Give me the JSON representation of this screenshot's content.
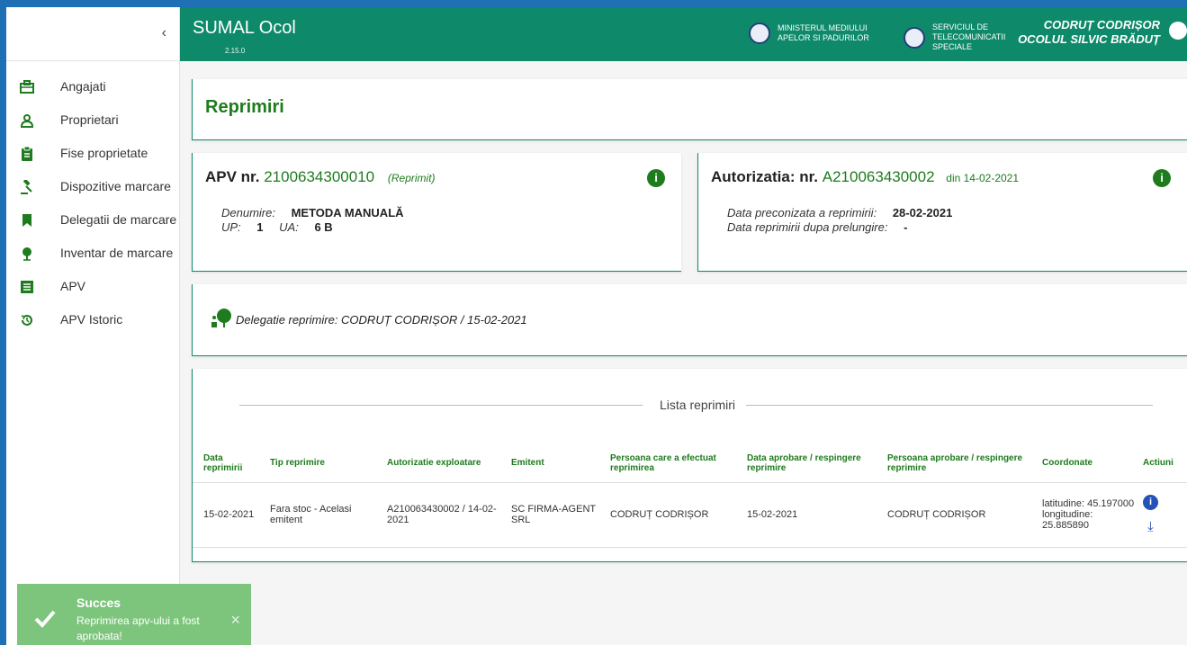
{
  "sidebar": {
    "collapse_glyph": "‹",
    "items": [
      {
        "label": "Angajati",
        "icon": "briefcase-icon"
      },
      {
        "label": "Proprietari",
        "icon": "person-icon"
      },
      {
        "label": "Fise proprietate",
        "icon": "clipboard-icon"
      },
      {
        "label": "Dispozitive marcare",
        "icon": "gavel-icon"
      },
      {
        "label": "Delegatii de marcare",
        "icon": "bookmark-icon"
      },
      {
        "label": "Inventar de marcare",
        "icon": "tree-icon"
      },
      {
        "label": "APV",
        "icon": "list-icon"
      },
      {
        "label": "APV Istoric",
        "icon": "history-icon"
      }
    ]
  },
  "topbar": {
    "app_title": "SUMAL Ocol",
    "version": "2.15.0",
    "org1": "MINISTERUL MEDIULUI APELOR SI PADURILOR",
    "org2": "SERVICIUL DE TELECOMUNICATII SPECIALE",
    "user_name": "CODRUȚ CODRIȘOR",
    "user_unit": "OCOLUL SILVIC BRĂDUȚ"
  },
  "page": {
    "title": "Reprimiri"
  },
  "apv_card": {
    "label": "APV nr.",
    "number": "2100634300010",
    "tag": "(Reprimit)",
    "denumire_label": "Denumire:",
    "denumire_value": "METODA MANUALĂ",
    "up_label": "UP:",
    "up_value": "1",
    "ua_label": "UA:",
    "ua_value": "6 B"
  },
  "auth_card": {
    "label": "Autorizatia: nr.",
    "number": "A210063430002",
    "date": "din 14-02-2021",
    "preconizata_label": "Data preconizata a reprimirii:",
    "preconizata_value": "28-02-2021",
    "prelungire_label": "Data reprimirii dupa prelungire:",
    "prelungire_value": "-"
  },
  "delegation": {
    "text": "Delegatie reprimire:  CODRUȚ CODRIȘOR / 15-02-2021"
  },
  "list": {
    "title": "Lista reprimiri",
    "columns": [
      "Data reprimirii",
      "Tip reprimire",
      "Autorizatie exploatare",
      "Emitent",
      "Persoana care a efectuat reprimirea",
      "Data aprobare / respingere reprimire",
      "Persoana aprobare / respingere reprimire",
      "Coordonate",
      "Actiuni"
    ],
    "rows": [
      {
        "data": "15-02-2021",
        "tip": "Fara stoc  - Acelasi emitent",
        "autorizatie": "A210063430002 / 14-02-2021",
        "emitent": "SC FIRMA-AGENT SRL",
        "persoana": "CODRUȚ CODRIȘOR",
        "data_aprobare": "15-02-2021",
        "persoana_aprobare": "CODRUȚ CODRIȘOR",
        "coordonate": "latitudine: 45.197000 longitudine: 25.885890"
      }
    ]
  },
  "toast": {
    "title": "Succes",
    "message": "Reprimirea apv-ului a fost aprobata!",
    "close_glyph": "×"
  },
  "colors": {
    "topbar": "#0e8a6a",
    "accent_green": "#1e7b1e",
    "action_blue": "#2452b8",
    "toast_bg": "#7dc57c"
  }
}
